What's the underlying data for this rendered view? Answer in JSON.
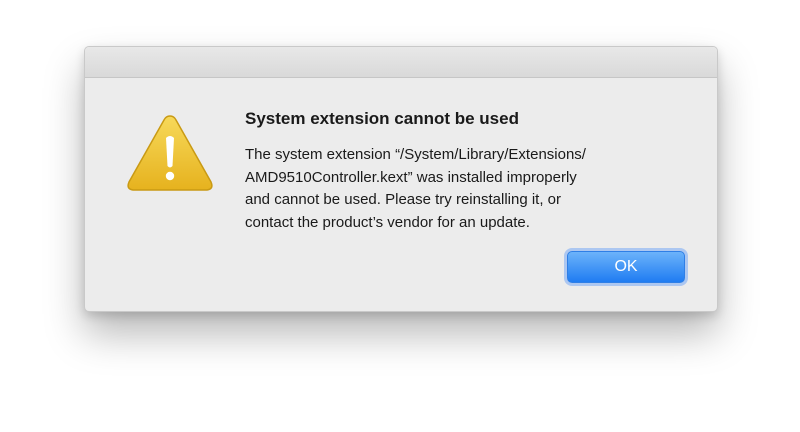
{
  "dialog": {
    "title": "System extension cannot be used",
    "message_lines": [
      "The system extension “/System/Library/Extensions/",
      "AMD9510Controller.kext” was installed improperly",
      "and cannot be used. Please try reinstalling it, or",
      "contact the product’s vendor for an update."
    ],
    "ok_label": "OK",
    "icon": "warning-icon"
  },
  "colors": {
    "dialog_background": "#ececec",
    "button_accent": "#1f7cf2",
    "warning_yellow": "#f2c832"
  }
}
